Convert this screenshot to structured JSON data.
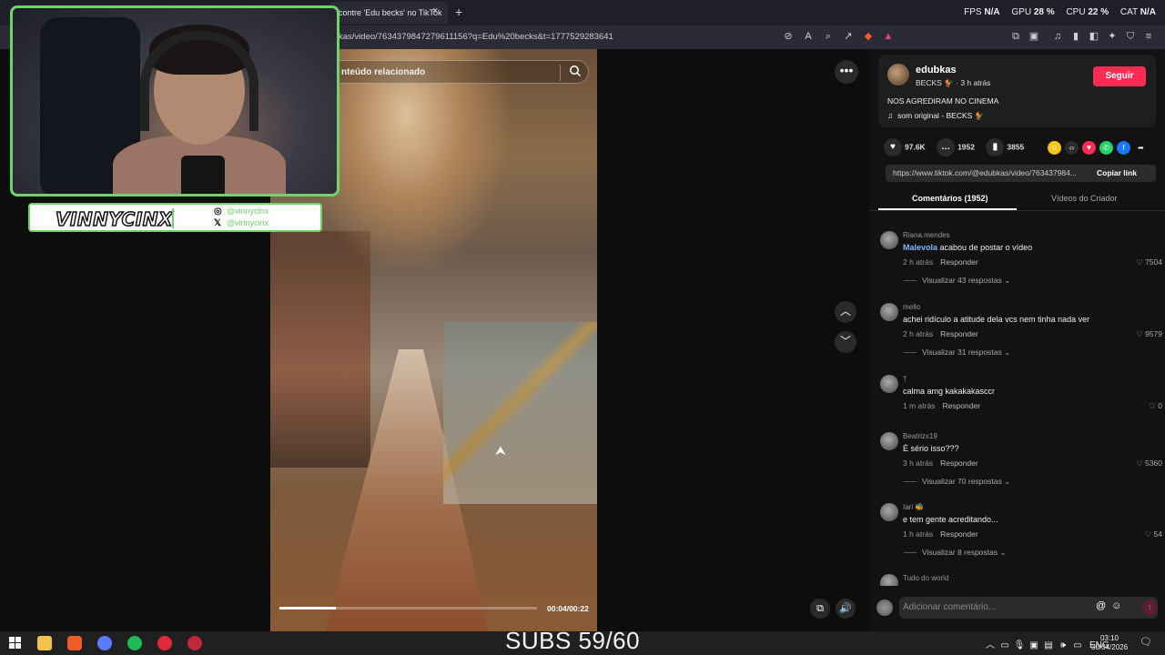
{
  "browser": {
    "tab_title": "contre 'Edu becks' no TikTok",
    "tab_close": "×",
    "new_tab": "+",
    "url": "kas/video/7634379847279611156?q=Edu%20becks&t=1777529283641",
    "perf": {
      "fps_label": "FPS",
      "fps_value": "N/A",
      "gpu_label": "GPU",
      "gpu_value": "28 %",
      "cpu_label": "CPU",
      "cpu_value": "22 %",
      "cat_label": "CAT",
      "cat_value": "N/A"
    }
  },
  "video": {
    "search_placeholder": "nteúdo relacionado",
    "time": "00:04/00:22",
    "progress": 0.22
  },
  "overlay": {
    "streamer_name": "VINNYCINX",
    "instagram": "@vinnycinx",
    "x_handle": "@vinnycinx"
  },
  "post": {
    "author": "edubkas",
    "author_sub": "BECKS 🐓 · 3 h atrás",
    "follow_label": "Seguir",
    "description": "NOS AGREDIRAM NO CINEMA",
    "sound": "som original - BECKS 🐓",
    "likes": "97.6K",
    "comments_count": "1952",
    "saves": "3855",
    "link": "https://www.tiktok.com/@edubkas/video/763437984...",
    "copy_label": "Copiar link",
    "tab_comments": "Comentários (1952)",
    "tab_creator": "Vídeos do Criador"
  },
  "comments": [
    {
      "user": "Riana.mendes",
      "mention": "Malevola",
      "text": " acabou de postar o vídeo",
      "time": "2 h atrás",
      "reply": "Responder",
      "likes": "7504",
      "replies": "Visualizar 43 respostas"
    },
    {
      "user": "mello",
      "mention": "",
      "text": "achei ridículo a atitude dela vcs nem tinha nada ver",
      "time": "2 h atrás",
      "reply": "Responder",
      "likes": "9579",
      "replies": "Visualizar 31 respostas"
    },
    {
      "user": "†",
      "mention": "",
      "text": "calma amg kakakakasccr",
      "time": "1 m atrás",
      "reply": "Responder",
      "likes": "0",
      "replies": ""
    },
    {
      "user": "Beatrizx19",
      "mention": "",
      "text": "É sério isso???",
      "time": "3 h atrás",
      "reply": "Responder",
      "likes": "5360",
      "replies": "Visualizar 70 respostas"
    },
    {
      "user": "Iari 🐝",
      "mention": "",
      "text": "e tem gente acreditando...",
      "time": "1 h atrás",
      "reply": "Responder",
      "likes": "54",
      "replies": "Visualizar 8 respostas"
    },
    {
      "user": "Tudo do world",
      "mention": "",
      "text": "",
      "time": "",
      "reply": "",
      "likes": "",
      "replies": ""
    }
  ],
  "comment_input": {
    "placeholder": "Adicionar comentário..."
  },
  "taskbar": {
    "subs": "SUBS 59/60",
    "lang": "ENG",
    "time": "03:10",
    "date": "30/04/2026"
  }
}
